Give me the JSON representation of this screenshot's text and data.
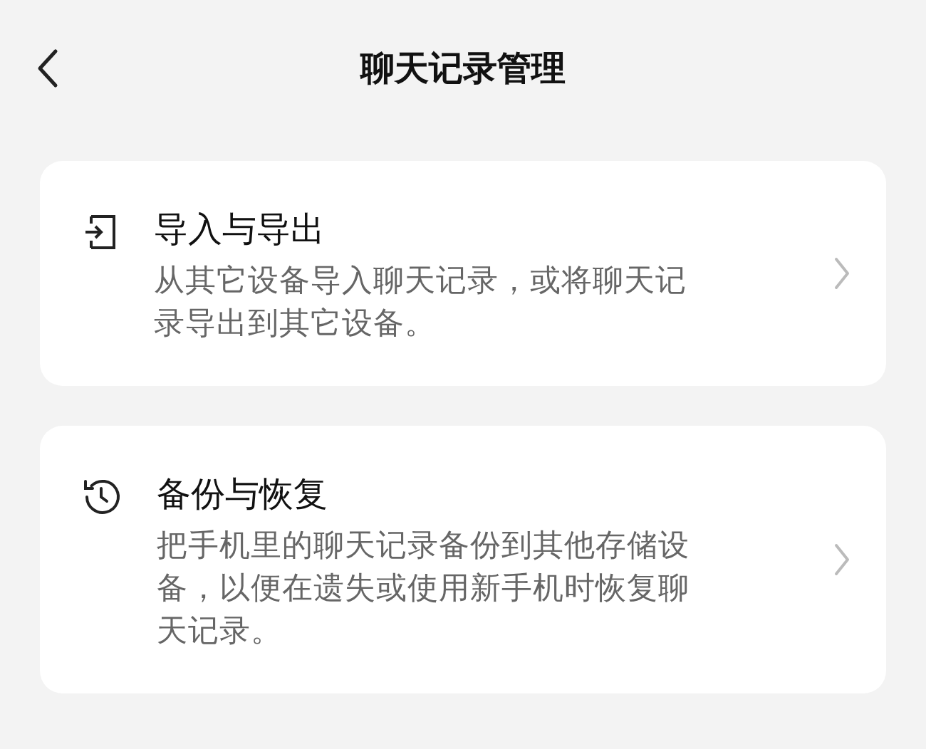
{
  "header": {
    "title": "聊天记录管理"
  },
  "cards": [
    {
      "kind": "import",
      "title": "导入与导出",
      "description": "从其它设备导入聊天记录，或将聊天记录导出到其它设备。"
    },
    {
      "kind": "history",
      "title": "备份与恢复",
      "description": "把手机里的聊天记录备份到其他存储设备，以便在遗失或使用新手机时恢复聊天记录。"
    }
  ]
}
